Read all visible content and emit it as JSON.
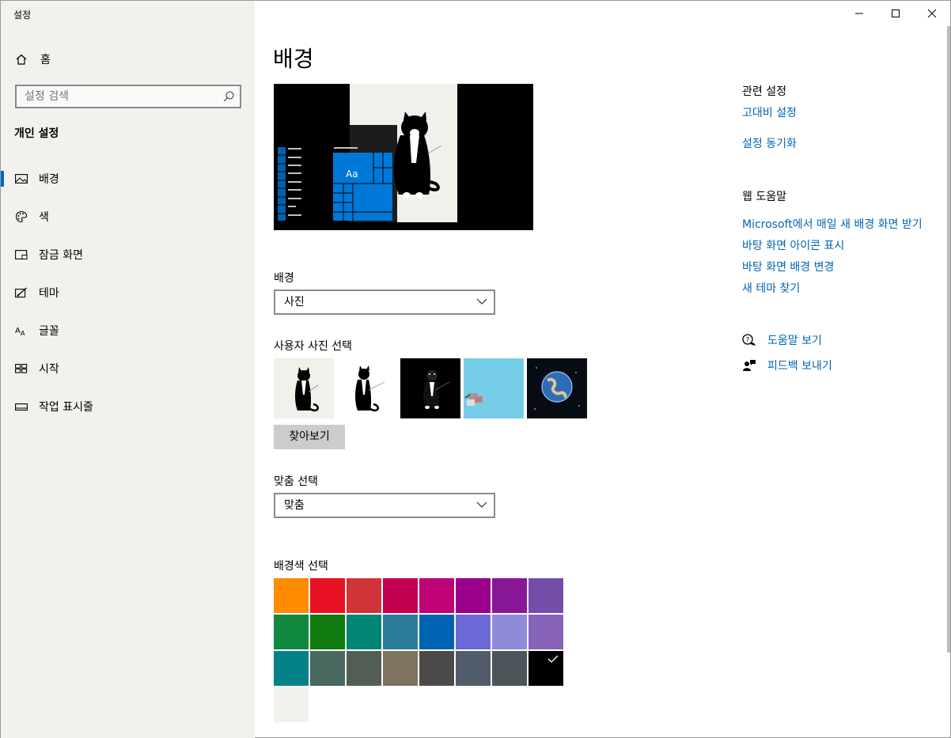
{
  "app_title": "설정",
  "sidebar": {
    "home_label": "홈",
    "search_placeholder": "설정 검색",
    "section_title": "개인 설정",
    "items": [
      {
        "label": "배경",
        "icon": "picture-icon"
      },
      {
        "label": "색",
        "icon": "palette-icon"
      },
      {
        "label": "잠금 화면",
        "icon": "lock-screen-icon"
      },
      {
        "label": "테마",
        "icon": "theme-icon"
      },
      {
        "label": "글꼴",
        "icon": "font-icon"
      },
      {
        "label": "시작",
        "icon": "start-icon"
      },
      {
        "label": "작업 표시줄",
        "icon": "taskbar-icon"
      }
    ],
    "active_item": "배경"
  },
  "main": {
    "title": "배경",
    "preview_tile_text": "Aa",
    "background_label": "배경",
    "background_value": "사진",
    "choose_picture_label": "사용자 사진 선택",
    "browse_label": "찾아보기",
    "fit_label": "맞춤 선택",
    "fit_value": "맞춤",
    "color_label": "배경색 선택",
    "colors": [
      "#ff8c00",
      "#e81123",
      "#d13438",
      "#c30052",
      "#bf0077",
      "#9a0089",
      "#881798",
      "#744da9",
      "#10893e",
      "#107c10",
      "#018574",
      "#2d7d9a",
      "#0063b1",
      "#6b69d6",
      "#8e8cd8",
      "#8764b8",
      "#038387",
      "#486860",
      "#525e54",
      "#7e735f",
      "#4c4a48",
      "#515c6b",
      "#4a5459",
      "#000000",
      "#f2f1ec"
    ],
    "selected_color": "#000000"
  },
  "related": {
    "title": "관련 설정",
    "links": [
      "고대비 설정",
      "설정 동기화"
    ]
  },
  "web_help": {
    "title": "웹 도움말",
    "links": [
      "Microsoft에서 매일 새 배경 화면 받기",
      "바탕 화면 아이콘 표시",
      "바탕 화면 배경 변경",
      "새 테마 찾기"
    ]
  },
  "help": {
    "get_help": "도움말 보기",
    "feedback": "피드백 보내기"
  },
  "accent_color": "#0063b1"
}
